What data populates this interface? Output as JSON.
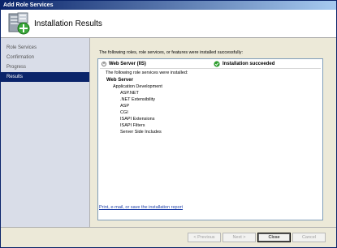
{
  "window": {
    "title": "Add Role Services"
  },
  "header": {
    "title": "Installation Results",
    "icon": "server-add-icon"
  },
  "nav": {
    "items": [
      {
        "label": "Role Services",
        "active": false
      },
      {
        "label": "Confirmation",
        "active": false
      },
      {
        "label": "Progress",
        "active": false
      },
      {
        "label": "Results",
        "active": true
      }
    ]
  },
  "main": {
    "intro": "The following roles, role services, or features were installed successfully:",
    "role": {
      "collapse_glyph": "^",
      "name": "Web Server (IIS)",
      "status": "Installation succeeded",
      "status_icon": "check-circle-icon",
      "installed_text": "The following role services were installed:",
      "tree": [
        {
          "level": 0,
          "label": "Web Server"
        },
        {
          "level": 1,
          "label": "Application Development"
        },
        {
          "level": 2,
          "label": "ASP.NET"
        },
        {
          "level": 2,
          "label": ".NET Extensibility"
        },
        {
          "level": 2,
          "label": "ASP"
        },
        {
          "level": 2,
          "label": "CGI"
        },
        {
          "level": 2,
          "label": "ISAPI Extensions"
        },
        {
          "level": 2,
          "label": "ISAPI Filters"
        },
        {
          "level": 2,
          "label": "Server Side Includes"
        }
      ]
    },
    "report_link": "Print, e-mail, or save the installation report"
  },
  "footer": {
    "previous": "< Previous",
    "next": "Next >",
    "close": "Close",
    "cancel": "Cancel"
  },
  "colors": {
    "title_bar": "#0a246a",
    "nav_active": "#0a246a",
    "success": "#2e9e2e",
    "link": "#1e3fa8"
  }
}
